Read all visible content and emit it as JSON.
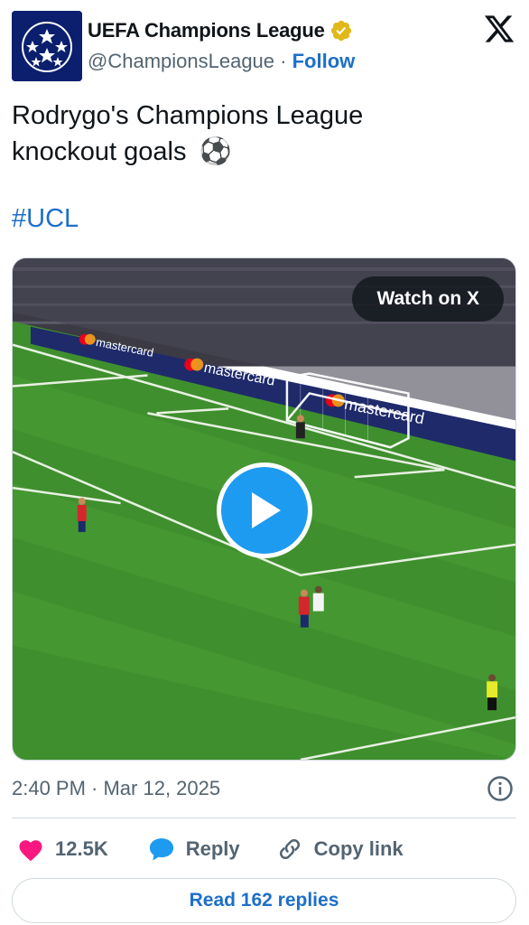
{
  "account": {
    "name": "UEFA Champions League",
    "handle": "@ChampionsLeague",
    "separator": "·",
    "follow_label": "Follow",
    "avatar_icon": "ucl-starball-logo",
    "verified_icon": "gold-verified-badge",
    "verified_color": "#e2b719"
  },
  "platform_icon": "x-logo",
  "tweet": {
    "line1": "Rodrygo's Champions League",
    "line2": "knockout goals",
    "emoji": "⚽",
    "hashtag": "#UCL"
  },
  "media": {
    "watch_label": "Watch on X",
    "play_icon": "play-icon",
    "ad_board_text": "mastercard"
  },
  "meta": {
    "timestamp": "2:40 PM · Mar 12, 2025",
    "info_icon": "info-icon"
  },
  "actions": {
    "like_count": "12.5K",
    "reply_label": "Reply",
    "copy_link_label": "Copy link"
  },
  "read_replies_label": "Read 162 replies",
  "colors": {
    "link_blue": "#1d6fc9",
    "play_blue": "#1d9bf0",
    "like_pink": "#f91880",
    "muted": "#536471"
  }
}
